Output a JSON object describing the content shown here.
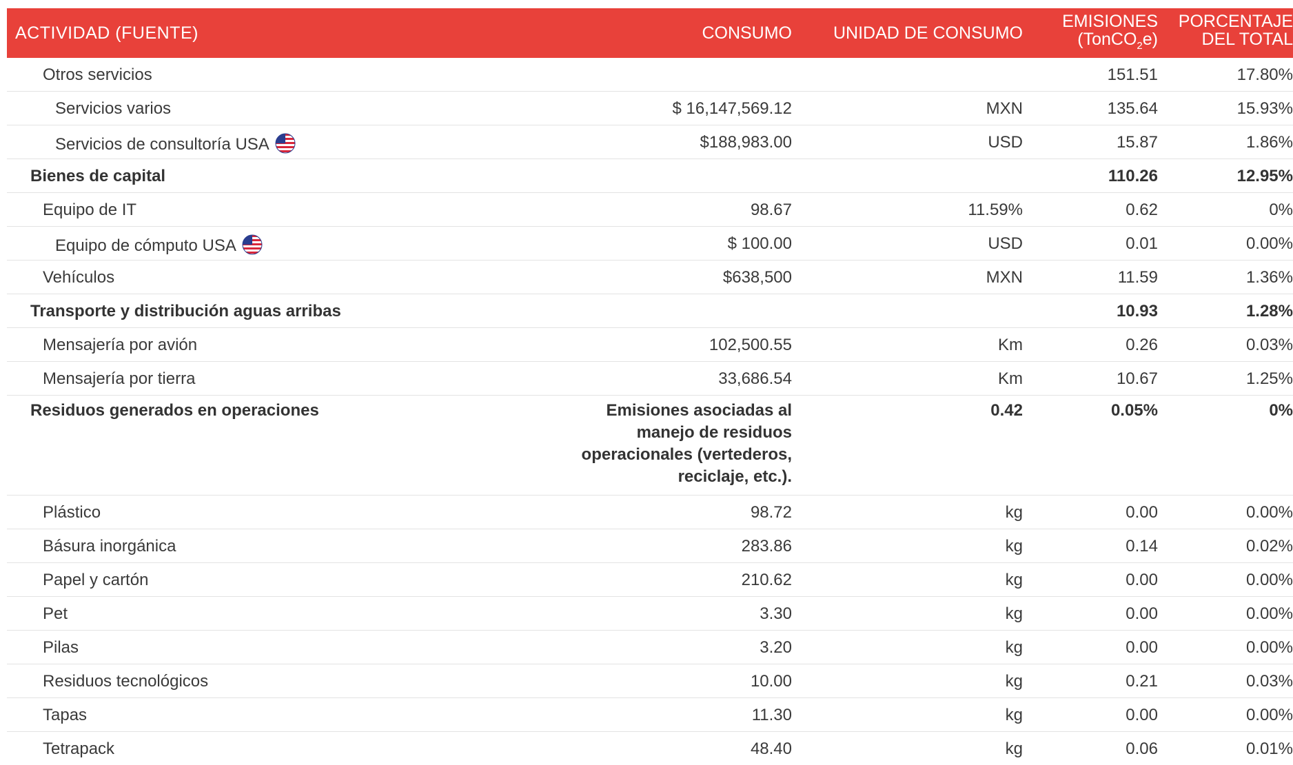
{
  "header": {
    "activity": "ACTIVIDAD (FUENTE)",
    "consumption": "CONSUMO",
    "unit": "UNIDAD DE CONSUMO",
    "emissions_line1": "EMISIONES",
    "emissions_line2_a": "(TonCO",
    "emissions_line2_sub": "2",
    "emissions_line2_b": "e)",
    "percent_line1": "PORCENTAJE",
    "percent_line2": "DEL TOTAL"
  },
  "colors": {
    "header_bg": "#e8413a",
    "header_text": "#ffffff",
    "row_divider": "#e3e3e3"
  },
  "rows": [
    {
      "activity": "Otros servicios",
      "consumption": "",
      "unit": "",
      "emissions": "151.51",
      "percent": "17.80%"
    },
    {
      "activity": "Servicios varios",
      "consumption": "$ 16,147,569.12",
      "unit": "MXN",
      "emissions": "135.64",
      "percent": "15.93%"
    },
    {
      "activity": "Servicios de consultoría USA",
      "consumption": "$188,983.00",
      "unit": "USD",
      "emissions": "15.87",
      "percent": "1.86%",
      "flag_icon": "us-flag-icon"
    },
    {
      "activity": "Bienes de capital",
      "consumption": "",
      "unit": "",
      "emissions": "110.26",
      "percent": "12.95%"
    },
    {
      "activity": "Equipo de IT",
      "consumption": "98.67",
      "unit": "11.59%",
      "emissions": "0.62",
      "percent": "0%"
    },
    {
      "activity": "Equipo de cómputo USA",
      "consumption": "$ 100.00",
      "unit": "USD",
      "emissions": "0.01",
      "percent": "0.00%",
      "flag_icon": "us-flag-icon"
    },
    {
      "activity": "Vehículos",
      "consumption": "$638,500",
      "unit": "MXN",
      "emissions": "11.59",
      "percent": "1.36%"
    },
    {
      "activity": "Transporte y distribución aguas arribas",
      "consumption": "",
      "unit": "",
      "emissions": "10.93",
      "percent": "1.28%"
    },
    {
      "activity": "Mensajería por avión",
      "consumption": "102,500.55",
      "unit": "Km",
      "emissions": "0.26",
      "percent": "0.03%"
    },
    {
      "activity": "Mensajería por tierra",
      "consumption": "33,686.54",
      "unit": "Km",
      "emissions": "10.67",
      "percent": "1.25%"
    },
    {
      "activity": "Residuos generados en operaciones",
      "consumption": "Emisiones asociadas al manejo de residuos operacionales (vertederos, reciclaje, etc.).",
      "unit": "0.42",
      "emissions": "0.05%",
      "percent": "0%"
    },
    {
      "activity": "Plástico",
      "consumption": "98.72",
      "unit": "kg",
      "emissions": "0.00",
      "percent": "0.00%"
    },
    {
      "activity": "Básura inorgánica",
      "consumption": "283.86",
      "unit": "kg",
      "emissions": "0.14",
      "percent": "0.02%"
    },
    {
      "activity": "Papel y cartón",
      "consumption": "210.62",
      "unit": "kg",
      "emissions": "0.00",
      "percent": "0.00%"
    },
    {
      "activity": "Pet",
      "consumption": "3.30",
      "unit": "kg",
      "emissions": "0.00",
      "percent": "0.00%"
    },
    {
      "activity": "Pilas",
      "consumption": "3.20",
      "unit": "kg",
      "emissions": "0.00",
      "percent": "0.00%"
    },
    {
      "activity": "Residuos tecnológicos",
      "consumption": "10.00",
      "unit": "kg",
      "emissions": "0.21",
      "percent": "0.03%"
    },
    {
      "activity": "Tapas",
      "consumption": "11.30",
      "unit": "kg",
      "emissions": "0.00",
      "percent": "0.00%"
    },
    {
      "activity": "Tetrapack",
      "consumption": "48.40",
      "unit": "kg",
      "emissions": "0.06",
      "percent": "0.01%"
    }
  ]
}
